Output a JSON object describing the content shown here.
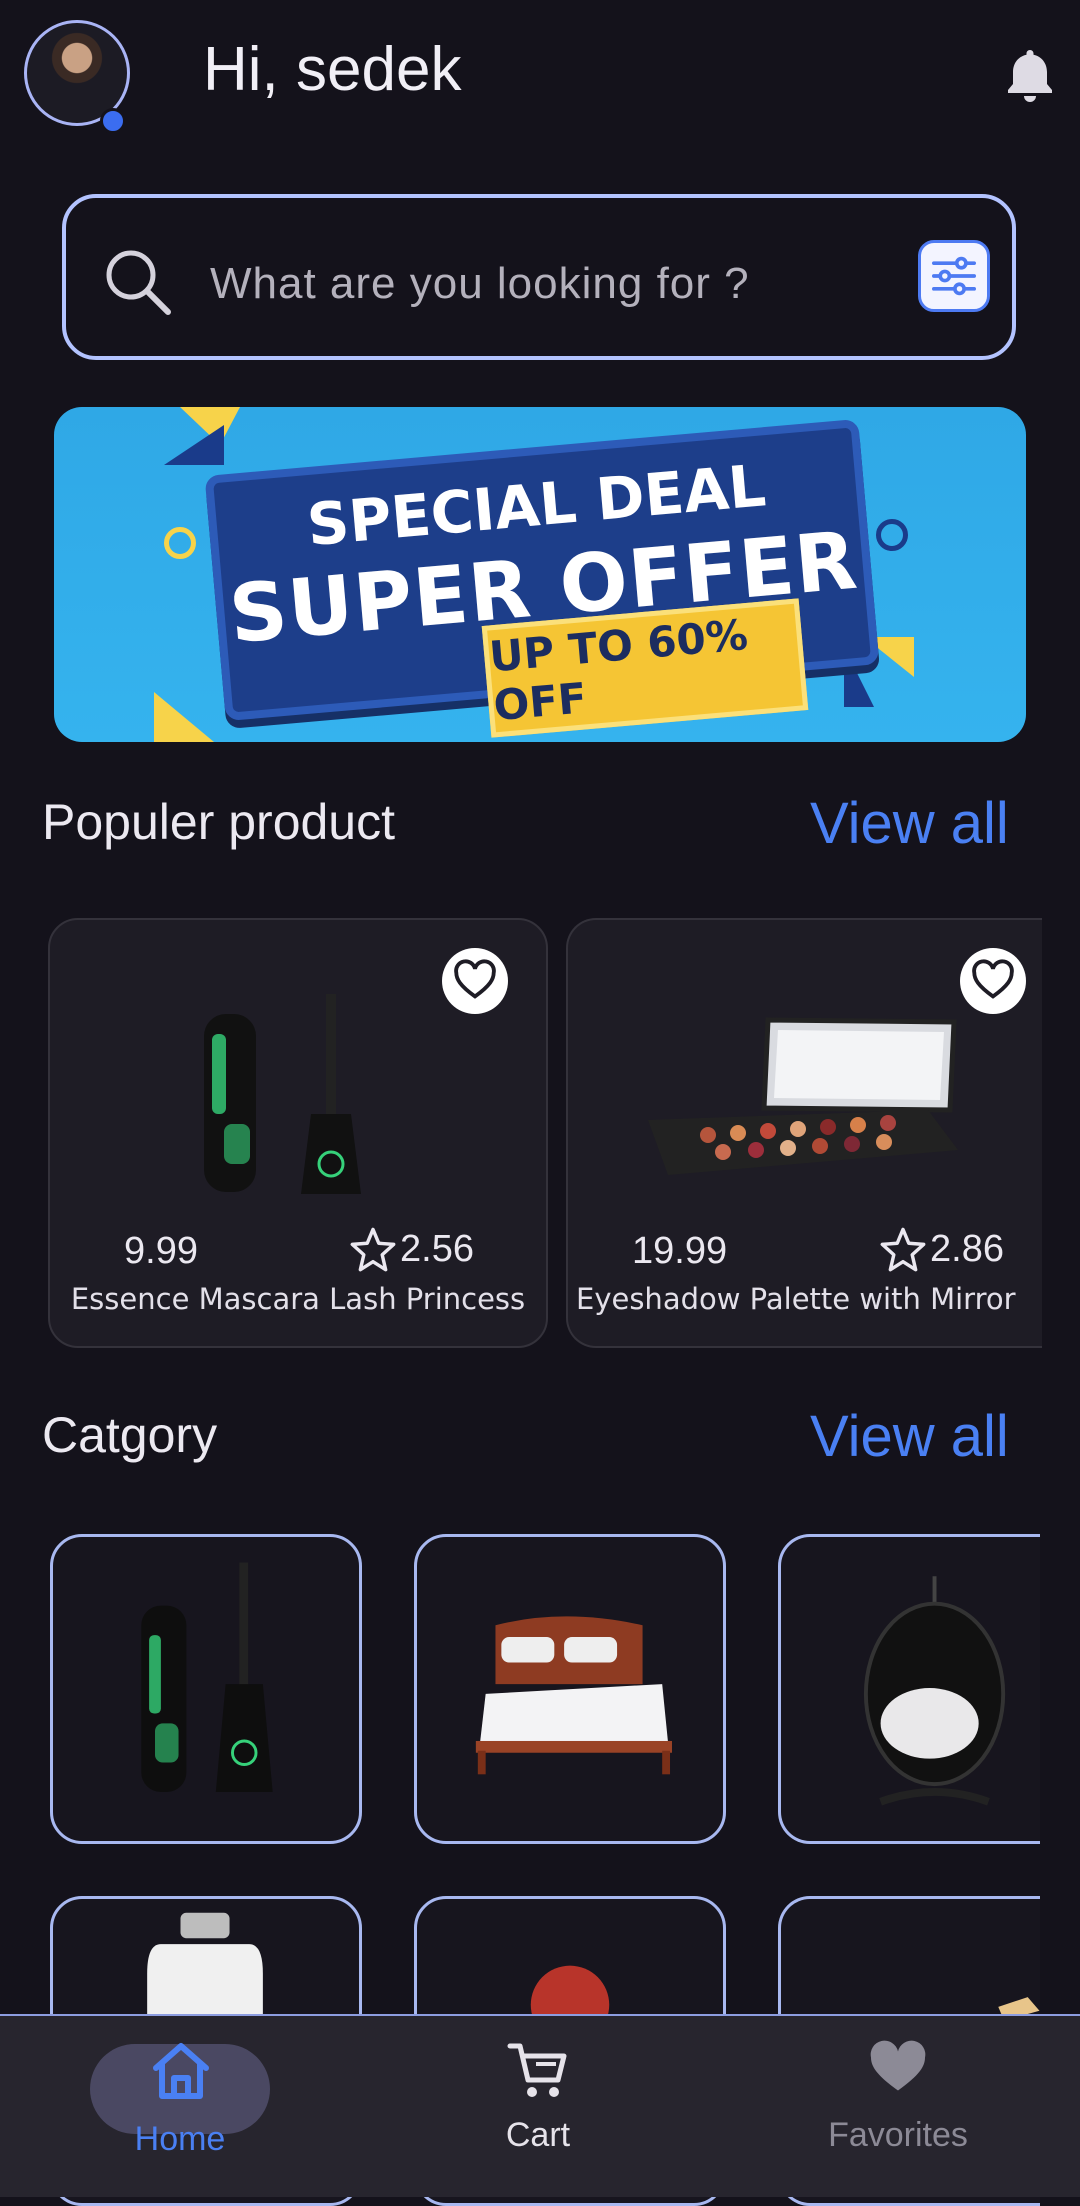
{
  "header": {
    "greeting": "Hi, sedek"
  },
  "search": {
    "placeholder": "What are you looking for ?"
  },
  "banner": {
    "line1": "SPECIAL DEAL",
    "line2": "SUPER OFFER",
    "tag": "UP TO 60% OFF"
  },
  "popular": {
    "title": "Populer product",
    "view_all": "View all",
    "products": [
      {
        "price": "9.99",
        "rating": "2.56",
        "name": "Essence Mascara Lash Princess"
      },
      {
        "price": "19.99",
        "rating": "2.86",
        "name": "Eyeshadow Palette with Mirror"
      }
    ]
  },
  "category": {
    "title": "Catgory",
    "view_all": "View all"
  },
  "nav": {
    "home": "Home",
    "cart": "Cart",
    "favorites": "Favorites"
  },
  "colors": {
    "accent": "#4a80f3",
    "background": "#14121b",
    "outline": "#b3c3ff"
  }
}
